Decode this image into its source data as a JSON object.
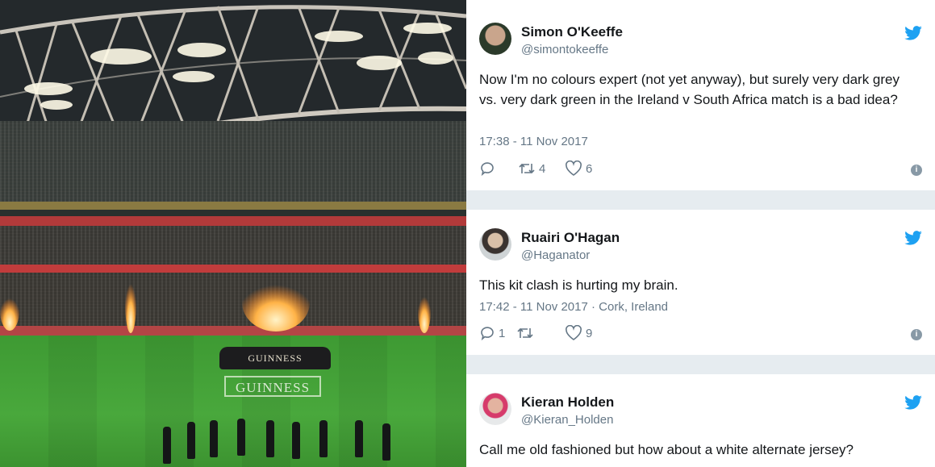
{
  "tweets": [
    {
      "name": "Simon O'Keeffe",
      "handle": "@simontokeeffe",
      "text": "Now I'm no colours expert (not yet anyway), but surely very dark grey vs. very dark green in the Ireland v South Africa match is a bad idea?",
      "meta": "17:38 - 11 Nov 2017",
      "replies": "",
      "retweets": "4",
      "likes": "6"
    },
    {
      "name": "Ruairi O'Hagan",
      "handle": "@Haganator",
      "text": "This kit clash is hurting my brain.",
      "meta": "17:42 - 11 Nov 2017 · Cork, Ireland",
      "replies": "1",
      "retweets": "",
      "likes": "9"
    },
    {
      "name": "Kieran Holden",
      "handle": "@Kieran_Holden",
      "text": "Call me old fashioned but how about a white alternate jersey?",
      "meta": "",
      "replies": "",
      "retweets": "",
      "likes": ""
    }
  ],
  "photo": {
    "banner_text": "GUINNESS",
    "pitch_logo_text": "GUINNESS"
  },
  "colors": {
    "twitter_blue": "#1da1f2",
    "text_dark": "#14171a",
    "text_muted": "#657786",
    "feed_background": "#e6ecf0",
    "pitch_green": "#49a83c"
  },
  "icons": {
    "bird": "twitter-bird-icon",
    "reply": "reply-icon",
    "retweet": "retweet-icon",
    "like": "heart-icon",
    "info": "info-icon"
  }
}
